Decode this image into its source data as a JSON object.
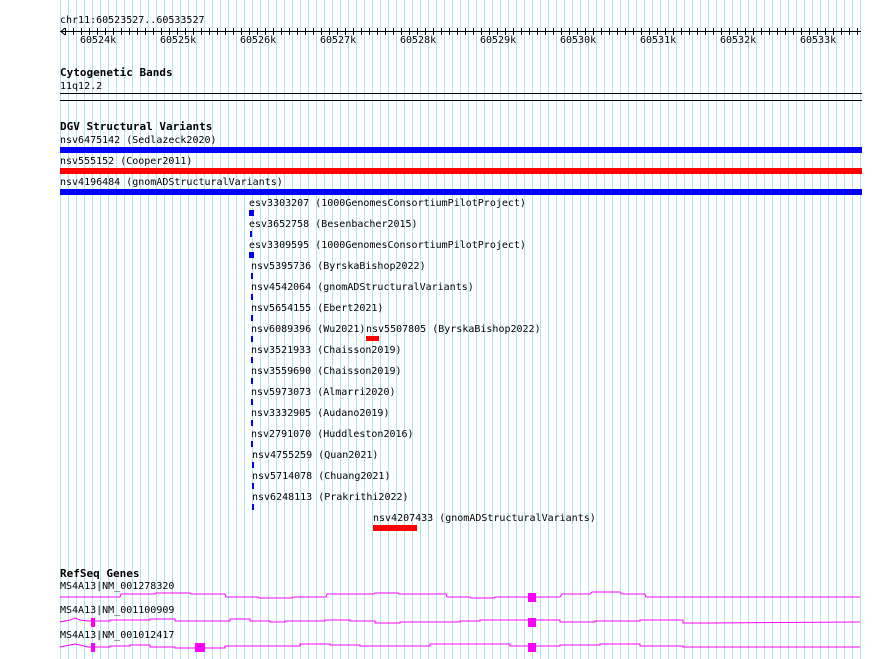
{
  "ruler": {
    "location": "chr11:60523527..60533527",
    "ticks": [
      "60524k",
      "60525k",
      "60526k",
      "60527k",
      "60528k",
      "60529k",
      "60530k",
      "60531k",
      "60532k",
      "60533k"
    ]
  },
  "cyto": {
    "title": "Cytogenetic Bands",
    "band": "11q12.2"
  },
  "dgv": {
    "title": "DGV Structural Variants",
    "items": [
      {
        "label": "nsv6475142 (Sedlazeck2020)"
      },
      {
        "label": "nsv555152 (Cooper2011)"
      },
      {
        "label": "nsv4196484 (gnomADStructuralVariants)"
      },
      {
        "label": "esv3303207 (1000GenomesConsortiumPilotProject)"
      },
      {
        "label": "esv3652758 (Besenbacher2015)"
      },
      {
        "label": "esv3309595 (1000GenomesConsortiumPilotProject)"
      },
      {
        "label": "nsv5395736 (ByrskaBishop2022)"
      },
      {
        "label": "nsv4542064 (gnomADStructuralVariants)"
      },
      {
        "label": "nsv5654155 (Ebert2021)"
      },
      {
        "label": "nsv6089396 (Wu2021)"
      },
      {
        "label": "nsv5507805 (ByrskaBishop2022)"
      },
      {
        "label": "nsv3521933 (Chaisson2019)"
      },
      {
        "label": "nsv3559690 (Chaisson2019)"
      },
      {
        "label": "nsv5973073 (Almarri2020)"
      },
      {
        "label": "nsv3332905 (Audano2019)"
      },
      {
        "label": "nsv2791070 (Huddleston2016)"
      },
      {
        "label": "nsv4755259 (Quan2021)"
      },
      {
        "label": "nsv5714078 (Chuang2021)"
      },
      {
        "label": "nsv6248113 (Prakrithi2022)"
      },
      {
        "label": "nsv4207433 (gnomADStructuralVariants)"
      }
    ]
  },
  "refseq": {
    "title": "RefSeq Genes",
    "genes": [
      {
        "label": "MS4A13|NM_001278320"
      },
      {
        "label": "MS4A13|NM_001100909"
      },
      {
        "label": "MS4A13|NM_001012417"
      }
    ]
  },
  "colors": {
    "gain": "#0000ff",
    "loss": "#ff0000",
    "gene": "#ff00ff",
    "grid_minor": "#a8e8f0",
    "grid_major": "#80c8f0"
  }
}
